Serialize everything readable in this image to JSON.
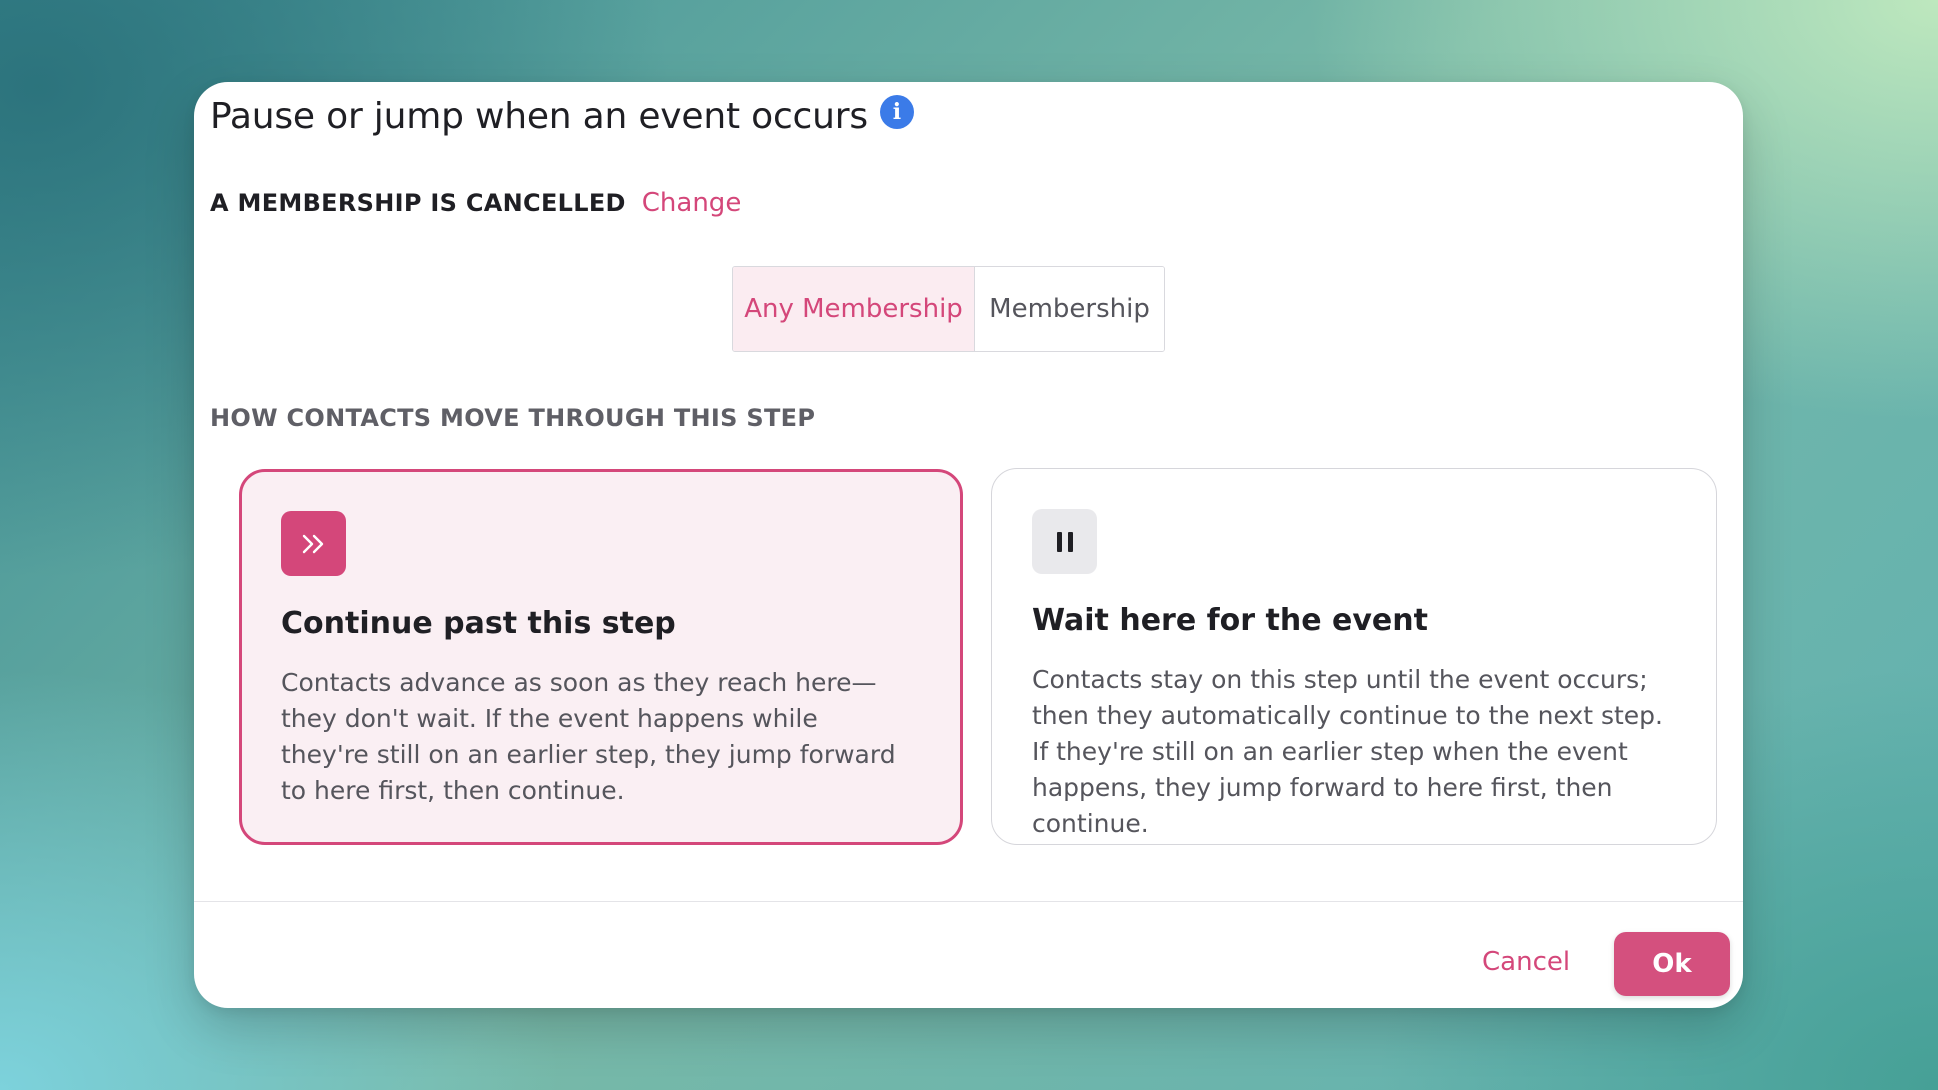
{
  "dialog": {
    "title": "Pause or jump when an event occurs",
    "info_icon": "info-icon"
  },
  "event": {
    "name": "A MEMBERSHIP IS CANCELLED",
    "change_label": "Change"
  },
  "membership_filter": {
    "options": [
      "Any Membership",
      "Membership"
    ],
    "selected": "Any Membership"
  },
  "movement": {
    "heading": "HOW CONTACTS MOVE THROUGH THIS STEP",
    "selected": "continue",
    "options": [
      {
        "id": "continue",
        "icon": "double-chevron-right-icon",
        "title": "Continue past this step",
        "description": "Contacts advance as soon as they reach here—they don't wait. If the event happens while they're still on an earlier step, they jump forward to here first, then continue."
      },
      {
        "id": "wait",
        "icon": "pause-icon",
        "title": "Wait here for the event",
        "description": "Contacts stay on this step until the event occurs; then they automatically continue to the next step. If they're still on an earlier step when the event happens, they jump forward to here first, then continue."
      }
    ]
  },
  "footer": {
    "cancel_label": "Cancel",
    "ok_label": "Ok"
  },
  "colors": {
    "accent": "#d4477a",
    "accent_light": "#faeff3",
    "info_blue": "#3b7be8"
  }
}
